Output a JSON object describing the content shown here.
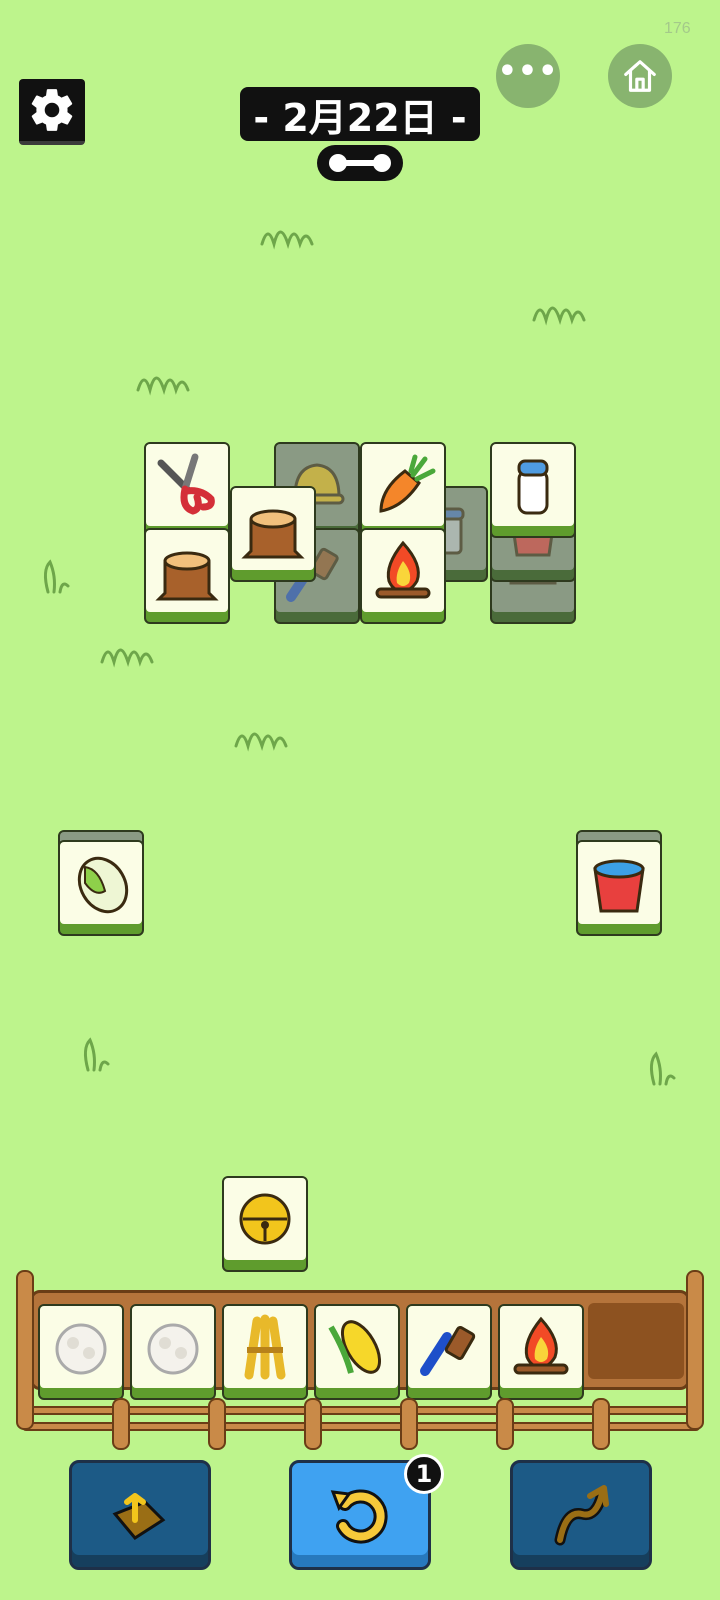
{
  "status": {
    "counter": "176"
  },
  "header": {
    "date": "- 2月22日 -",
    "settings_icon": "gear-icon",
    "more_icon": "more-dots-icon",
    "more_label": "•••",
    "home_icon": "home-icon",
    "progress_icon": "dumbbell-progress-icon"
  },
  "board": {
    "tiles": [
      {
        "item": "pruning-shears",
        "state": "free"
      },
      {
        "item": "bell",
        "state": "covered"
      },
      {
        "item": "carrot",
        "state": "free"
      },
      {
        "item": "milk-bottle",
        "state": "free"
      },
      {
        "item": "tree-stump",
        "state": "free"
      },
      {
        "item": "tree-stump",
        "state": "free"
      },
      {
        "item": "brush",
        "state": "covered"
      },
      {
        "item": "campfire",
        "state": "free"
      },
      {
        "item": "pot",
        "state": "covered"
      },
      {
        "item": "bucket",
        "state": "covered"
      },
      {
        "item": "bell",
        "state": "covered"
      },
      {
        "item": "cabbage",
        "state": "free"
      },
      {
        "item": "bucket",
        "state": "free"
      },
      {
        "item": "bell",
        "state": "free"
      }
    ]
  },
  "tray": {
    "capacity": 7,
    "items": [
      "cotton",
      "cotton",
      "wheat-bundle",
      "corn",
      "brush",
      "campfire"
    ]
  },
  "actions": {
    "remove_icon": "move-out-arrow-icon",
    "undo_icon": "undo-arrow-icon",
    "undo_count": "1",
    "shuffle_icon": "shuffle-arrows-icon"
  }
}
